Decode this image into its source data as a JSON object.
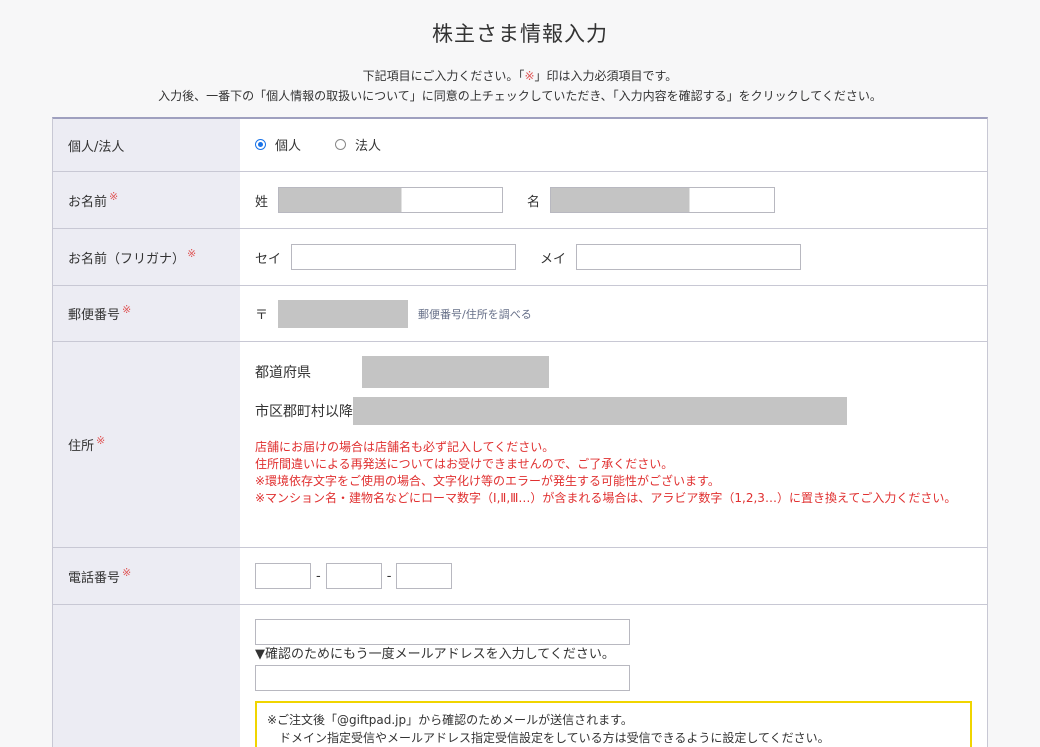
{
  "page": {
    "title": "株主さま情報入力",
    "intro_line1_pre": "下記項目にご入力ください。「",
    "intro_line1_mark": "※",
    "intro_line1_post": "」印は入力必須項目です。",
    "intro_line2": "入力後、一番下の「個人情報の取扱いについて」に同意の上チェックしていただき、「入力内容を確認する」をクリックしてください。"
  },
  "required_mark": "※",
  "form": {
    "type": {
      "label": "個人/法人",
      "options": [
        "個人",
        "法人"
      ],
      "selected": "個人"
    },
    "name": {
      "label": "お名前",
      "last_label": "姓",
      "first_label": "名",
      "last_filled_fraction": 0.55,
      "first_filled_fraction": 0.6
    },
    "kana": {
      "label": "お名前（フリガナ）",
      "last_label": "セイ",
      "first_label": "メイ"
    },
    "postal": {
      "label": "郵便番号",
      "prefix": "〒",
      "lookup_link": "郵便番号/住所を調べる"
    },
    "address": {
      "label": "住所",
      "pref_label": "都道府県",
      "city_label": "市区郡町村以降",
      "notices": [
        "店舗にお届けの場合は店舗名も必ず記入してください。",
        "住所間違いによる再発送についてはお受けできませんので、ご了承ください。",
        "※環境依存文字をご使用の場合、文字化け等のエラーが発生する可能性がございます。",
        "※マンション名・建物名などにローマ数字（Ⅰ,Ⅱ,Ⅲ…）が含まれる場合は、アラビア数字（1,2,3…）に置き換えてご入力ください。"
      ]
    },
    "phone": {
      "label": "電話番号",
      "separator": "-"
    },
    "email": {
      "confirm_hint": "▼確認のためにもう一度メールアドレスを入力してください。",
      "notice_line1": "※ご注文後「@giftpad.jp」から確認のためメールが送信されます。",
      "notice_line2": "　ドメイン指定受信やメールアドレス指定受信設定をしている方は受信できるように設定してください。"
    }
  },
  "colors": {
    "required": "#e05a5a",
    "notice_text": "#e03030",
    "radio_selected": "#1a73e8",
    "label_bg": "#ececf3",
    "notice_border": "#f0d500"
  }
}
